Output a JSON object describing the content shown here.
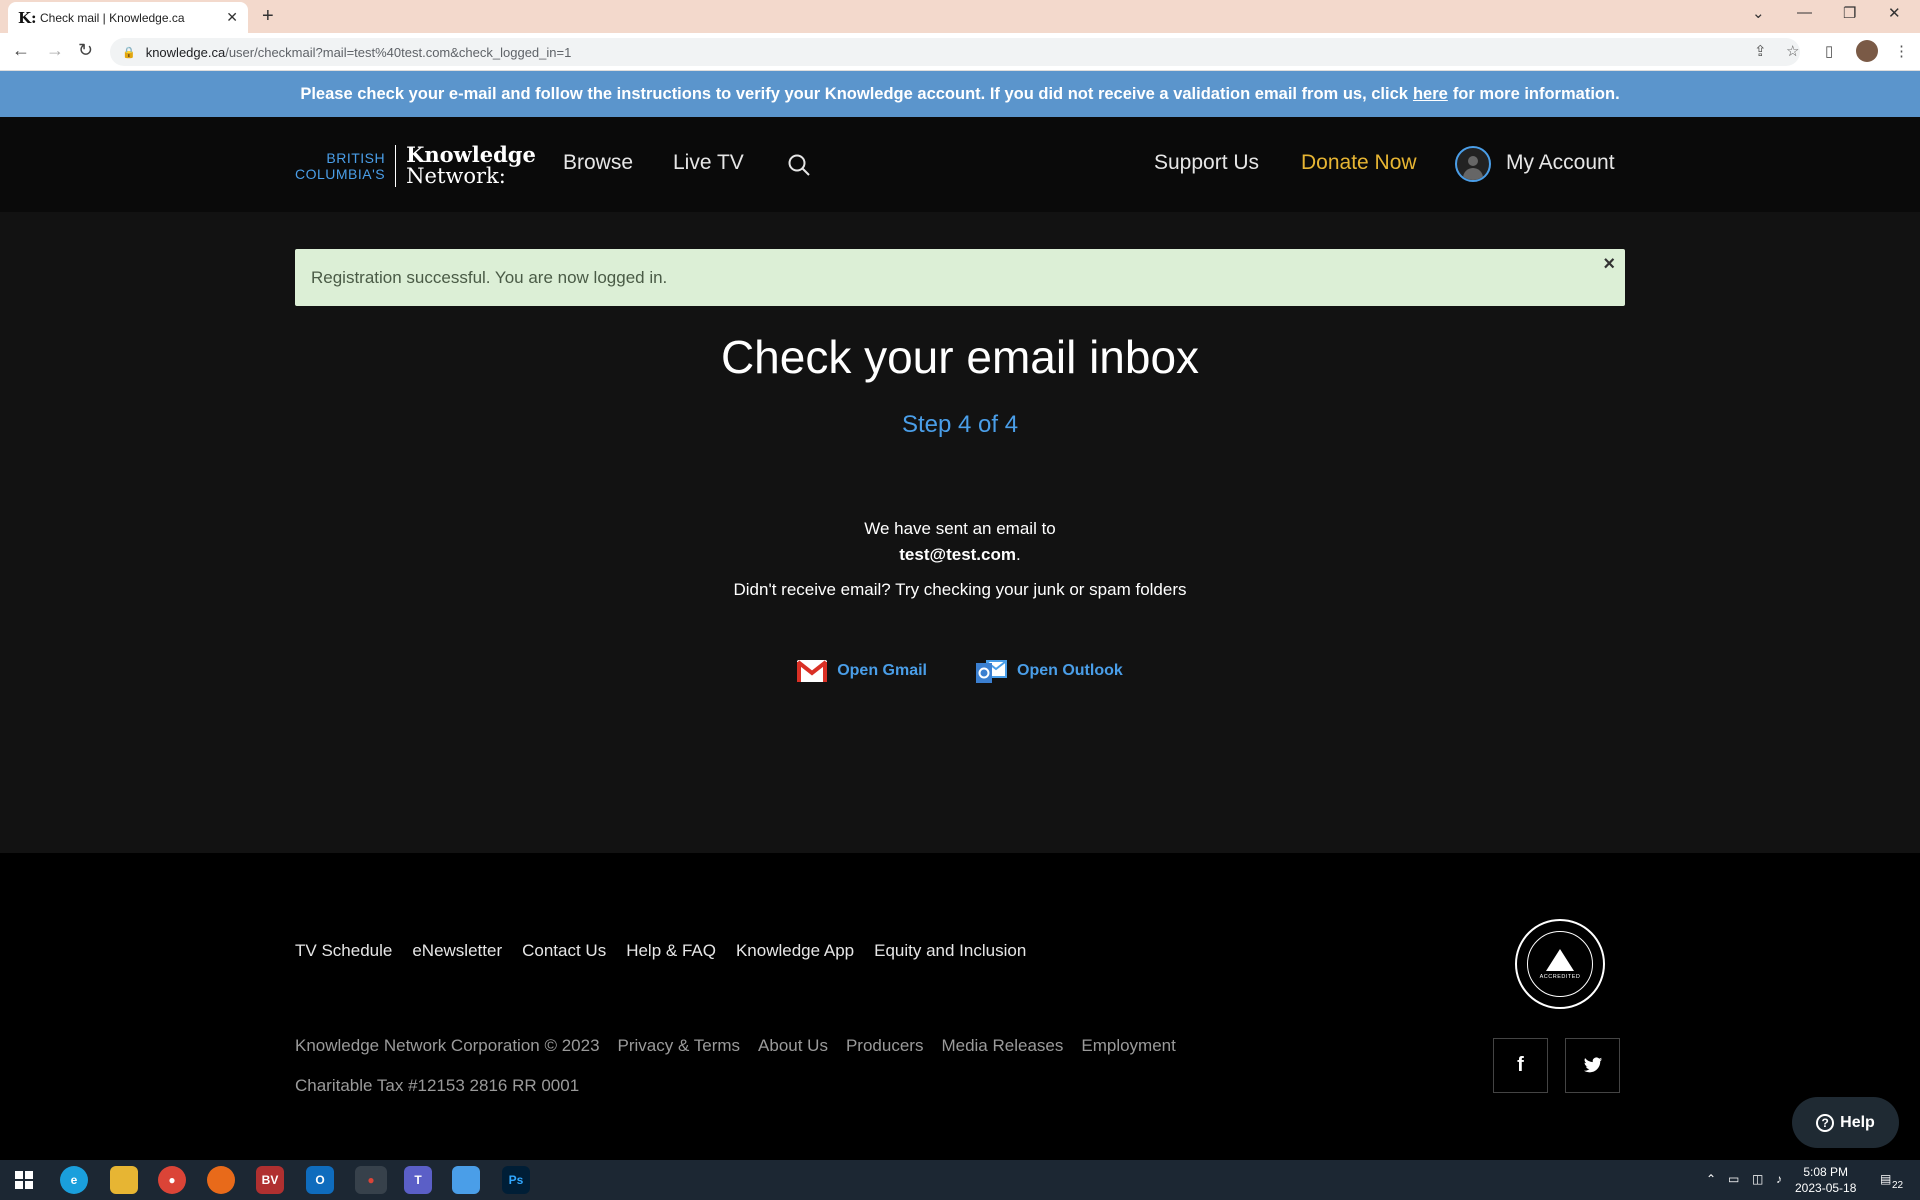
{
  "browser": {
    "tab_title": "Check mail | Knowledge.ca",
    "tab_favicon": "K:",
    "url_host": "knowledge.ca",
    "url_path": "/user/checkmail?mail=test%40test.com&check_logged_in=1"
  },
  "notice": {
    "text_before": "Please check your e-mail and follow the instructions to verify your Knowledge account. If you did not receive a validation email from us, click",
    "link": "here",
    "text_after": "for more information."
  },
  "header": {
    "logo_bc_line1": "BRITISH",
    "logo_bc_line2": "COLUMBIA'S",
    "logo_kn_line1": "Knowledge",
    "logo_kn_line2": "Network:",
    "nav": {
      "browse": "Browse",
      "live_tv": "Live TV",
      "support": "Support Us",
      "donate": "Donate Now",
      "account": "My Account"
    }
  },
  "main": {
    "alert": "Registration successful. You are now logged in.",
    "alert_close": "×",
    "title": "Check your email inbox",
    "step": "Step 4 of 4",
    "sent_line": "We have sent an email to",
    "email": "test@test.com",
    "email_suffix": ".",
    "junk_line": "Didn't receive email? Try checking your junk or spam folders",
    "open_gmail": "Open Gmail",
    "open_outlook": "Open Outlook"
  },
  "footer": {
    "links": [
      "TV Schedule",
      "eNewsletter",
      "Contact Us",
      "Help & FAQ",
      "Knowledge App",
      "Equity and Inclusion"
    ],
    "legal": [
      "Knowledge Network Corporation © 2023",
      "Privacy & Terms",
      "About Us",
      "Producers",
      "Media Releases",
      "Employment"
    ],
    "tax": "Charitable Tax #12153 2816 RR 0001",
    "badge_text": "ACCREDITED",
    "help": "Help"
  },
  "taskbar": {
    "time": "5:08 PM",
    "date": "2023-05-18",
    "notifications": "22"
  },
  "colors": {
    "accent_blue": "#4a9ee8",
    "donate_gold": "#e7b533",
    "notice_bg": "#5b95cc",
    "alert_bg": "#dcefd6"
  }
}
